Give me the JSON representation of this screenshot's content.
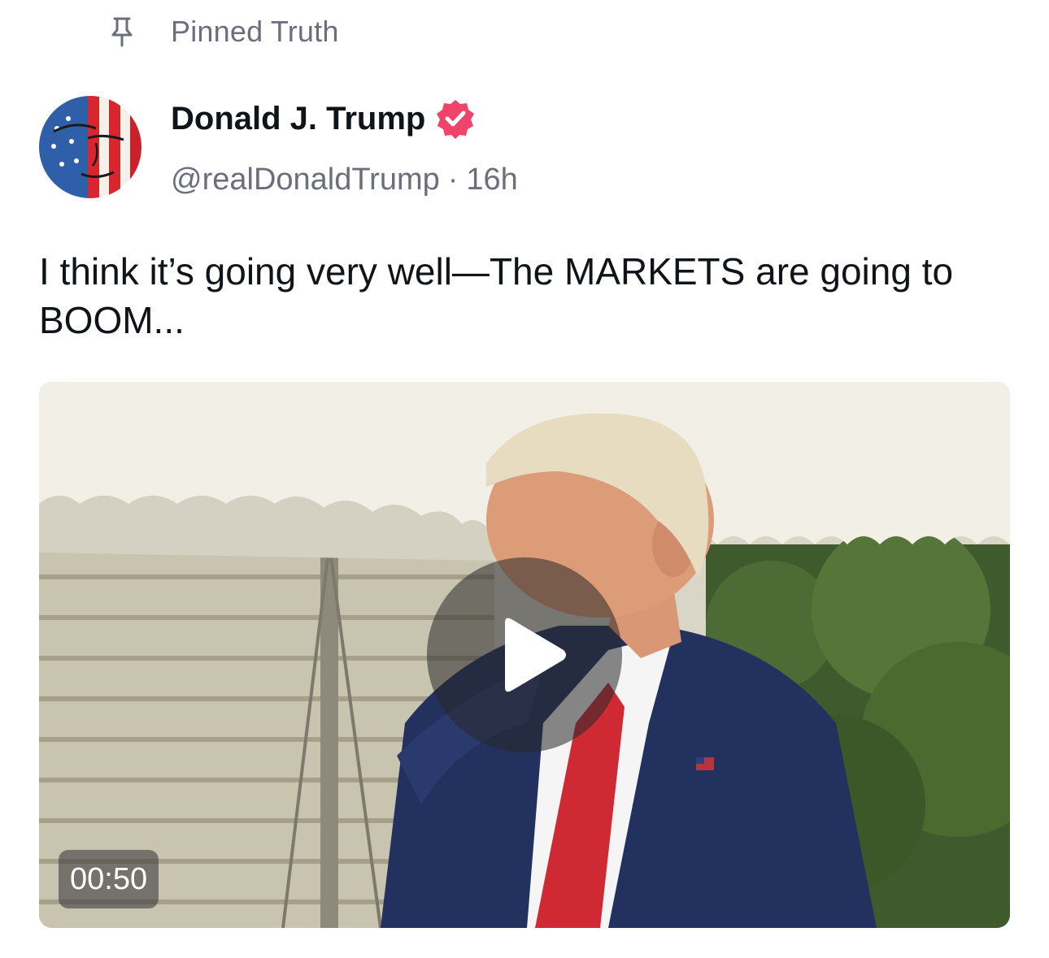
{
  "pinned": {
    "icon": "pin-icon",
    "label": "Pinned Truth"
  },
  "author": {
    "display_name": "Donald J. Trump",
    "verified_icon": "verified-badge-icon",
    "verified_color": "#f0436b",
    "handle": "@realDonaldTrump",
    "separator": "·",
    "time_ago": "16h"
  },
  "post": {
    "text": "I think it’s going very well—The MARKETS are going to BOOM..."
  },
  "media": {
    "type": "video",
    "play_icon": "play-icon",
    "duration": "00:50"
  },
  "colors": {
    "text_primary": "#0f1419",
    "text_secondary": "#6b6f7b",
    "accent": "#f0436b"
  }
}
